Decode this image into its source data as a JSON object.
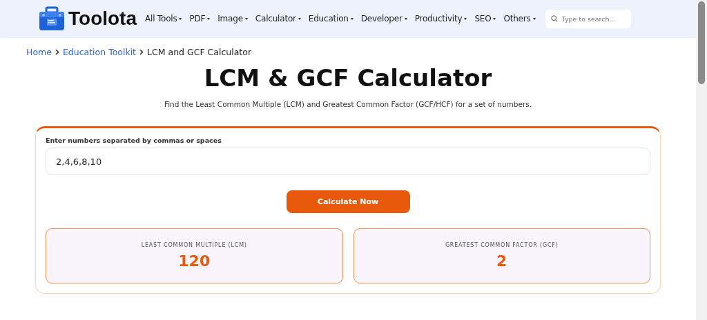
{
  "brand": {
    "name": "Toolota"
  },
  "nav": [
    {
      "label": "All Tools"
    },
    {
      "label": "PDF"
    },
    {
      "label": "Image"
    },
    {
      "label": "Calculator"
    },
    {
      "label": "Education"
    },
    {
      "label": "Developer"
    },
    {
      "label": "Productivity"
    },
    {
      "label": "SEO"
    },
    {
      "label": "Others"
    }
  ],
  "search": {
    "placeholder": "Type to search..."
  },
  "breadcrumb": [
    {
      "label": "Home",
      "link": true
    },
    {
      "label": "Education Toolkit",
      "link": true
    },
    {
      "label": "LCM and GCF Calculator",
      "link": false
    }
  ],
  "title": "LCM & GCF Calculator",
  "subtitle": "Find the Least Common Multiple (LCM) and Greatest Common Factor (GCF/HCF) for a set of numbers.",
  "form": {
    "label": "Enter numbers separated by commas or spaces",
    "value": "2,4,6,8,10",
    "button": "Calculate Now"
  },
  "results": [
    {
      "label": "LEAST COMMON MULTIPLE (LCM)",
      "value": "120"
    },
    {
      "label": "GREATEST COMMON FACTOR (GCF)",
      "value": "2"
    }
  ]
}
